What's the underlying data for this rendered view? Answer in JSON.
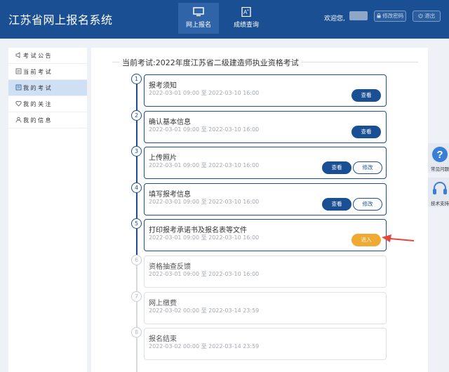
{
  "header": {
    "app_title": "江苏省网上报名系统",
    "tabs": [
      {
        "label": "网上报名",
        "icon": "monitor-icon",
        "active": true
      },
      {
        "label": "成绩查询",
        "icon": "grade-doc-icon",
        "active": false
      }
    ],
    "welcome": "欢迎您,",
    "change_password": "修改密码",
    "logout": "退出"
  },
  "sidebar": {
    "items": [
      {
        "label": "考 试 公 告",
        "icon": "announcement-icon",
        "active": false
      },
      {
        "label": "当 前 考 试",
        "icon": "current-exam-icon",
        "active": false
      },
      {
        "label": "我 的 考 试",
        "icon": "my-exam-icon",
        "active": true
      },
      {
        "label": "我 的 关 注",
        "icon": "heart-icon",
        "active": false
      },
      {
        "label": "我 的 信 息",
        "icon": "user-icon",
        "active": false
      }
    ]
  },
  "main": {
    "exam_title": "当前考试:2022年度江苏省二级建造师执业资格考试",
    "view_label": "查看",
    "edit_label": "修改",
    "enter_label": "进入",
    "steps": [
      {
        "num": "1",
        "title": "报考须知",
        "time": "2022-03-01 09:00 至 2022-03-10 16:00",
        "status": "done"
      },
      {
        "num": "2",
        "title": "确认基本信息",
        "time": "2022-03-01 09:00 至 2022-03-10 16:00",
        "status": "done"
      },
      {
        "num": "3",
        "title": "上传照片",
        "time": "2022-03-01 09:00 至 2022-03-10 16:00",
        "status": "done"
      },
      {
        "num": "4",
        "title": "填写报考信息",
        "time": "2022-03-01 09:00 至 2022-03-10 16:00",
        "status": "done"
      },
      {
        "num": "5",
        "title": "打印报考承诺书及报名表等文件",
        "time": "2022-03-01 09:00 至 2022-03-10 16:00",
        "status": "current"
      },
      {
        "num": "6",
        "title": "资格抽查反馈",
        "time": "2022-03-01 09:00 至 2022-03-10 16:00",
        "status": "future"
      },
      {
        "num": "7",
        "title": "网上缴费",
        "time": "2022-03-02 00:00 至 2022-03-14 23:59",
        "status": "future"
      },
      {
        "num": "8",
        "title": "报名结束",
        "time": "2022-03-02 00:00 至 2022-03-14 23:59",
        "status": "future"
      }
    ]
  },
  "float": {
    "faq": "常见问题",
    "support": "技术支持"
  },
  "colors": {
    "brand": "#1b4f93",
    "accent": "#f0a932",
    "arrow": "#e8453c"
  }
}
